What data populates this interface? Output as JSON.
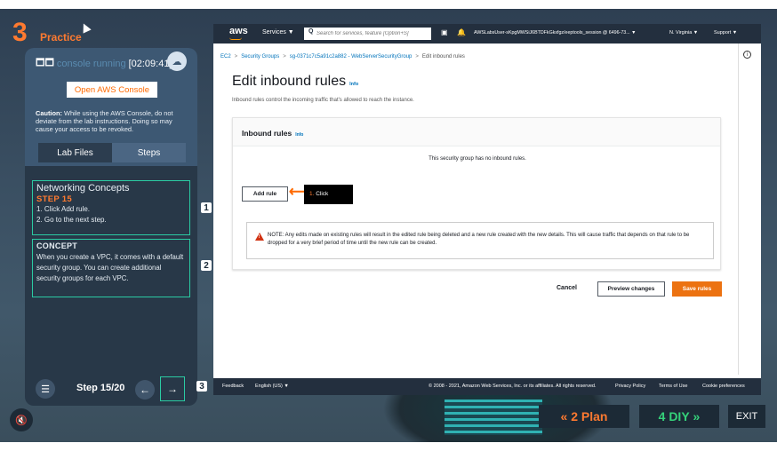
{
  "lab": {
    "step_badge": "3",
    "mode": "Practice",
    "console_status": "console running",
    "timer": "[02:09:41]",
    "open_console": "Open AWS Console",
    "caution_label": "Caution:",
    "caution_text": " While using the AWS Console, do not deviate from the lab instructions. Doing so may cause your access to be revoked.",
    "tabs": [
      "Lab Files",
      "Steps"
    ],
    "section_title": "Networking Concepts",
    "step_label": "STEP 15",
    "instructions": [
      "1. Click Add rule.",
      "2. Go to the next step."
    ],
    "concept_title": "CONCEPT",
    "concept_text": "When you create a VPC, it comes with a default security group. You can create additional security groups for each VPC.",
    "badges": [
      "1",
      "2",
      "3"
    ],
    "step_counter": "Step 15/20"
  },
  "nav": {
    "plan": "2  Plan",
    "diy": "4  DIY",
    "exit": "EXIT"
  },
  "aws": {
    "logo": "aws",
    "services": "Services ▼",
    "search_placeholder": "Search for services, feature [Option+S]",
    "account": "AWSLabsUser-sKpgMWSiJ6BTDFkGkxfgz/eeptools_session @ 6496-73... ▼",
    "region": "N. Virginia ▼",
    "support": "Support ▼",
    "breadcrumb": [
      "EC2",
      "Security Groups",
      "sg-0371c7c5a91c2a882 - WebServerSecurityGroup",
      "Edit inbound rules"
    ],
    "page_title": "Edit inbound rules",
    "info": "Info",
    "subtitle": "Inbound rules control the incoming traffic that's allowed to reach the instance.",
    "card_title": "Inbound rules",
    "empty_message": "This security group has no inbound rules.",
    "add_rule": "Add rule",
    "tooltip_num": "1.",
    "tooltip_text": " Click",
    "note": "NOTE: Any edits made on existing rules will result in the edited rule being deleted and a new rule created with the new details. This will cause traffic that depends on that rule to be dropped for a very brief period of time until the new rule can be created.",
    "cancel": "Cancel",
    "preview": "Preview changes",
    "save": "Save rules",
    "footer": {
      "feedback": "Feedback",
      "language": "English (US) ▼",
      "copyright": "© 2008 - 2021, Amazon Web Services, Inc. or its affiliates. All rights reserved.",
      "privacy": "Privacy Policy",
      "terms": "Terms of Use",
      "cookies": "Cookie preferences"
    }
  },
  "colors": {
    "accent": "#ff7a30",
    "teal": "#2bcba3",
    "aws_orange": "#ec7211",
    "aws_dark": "#232f3e"
  }
}
